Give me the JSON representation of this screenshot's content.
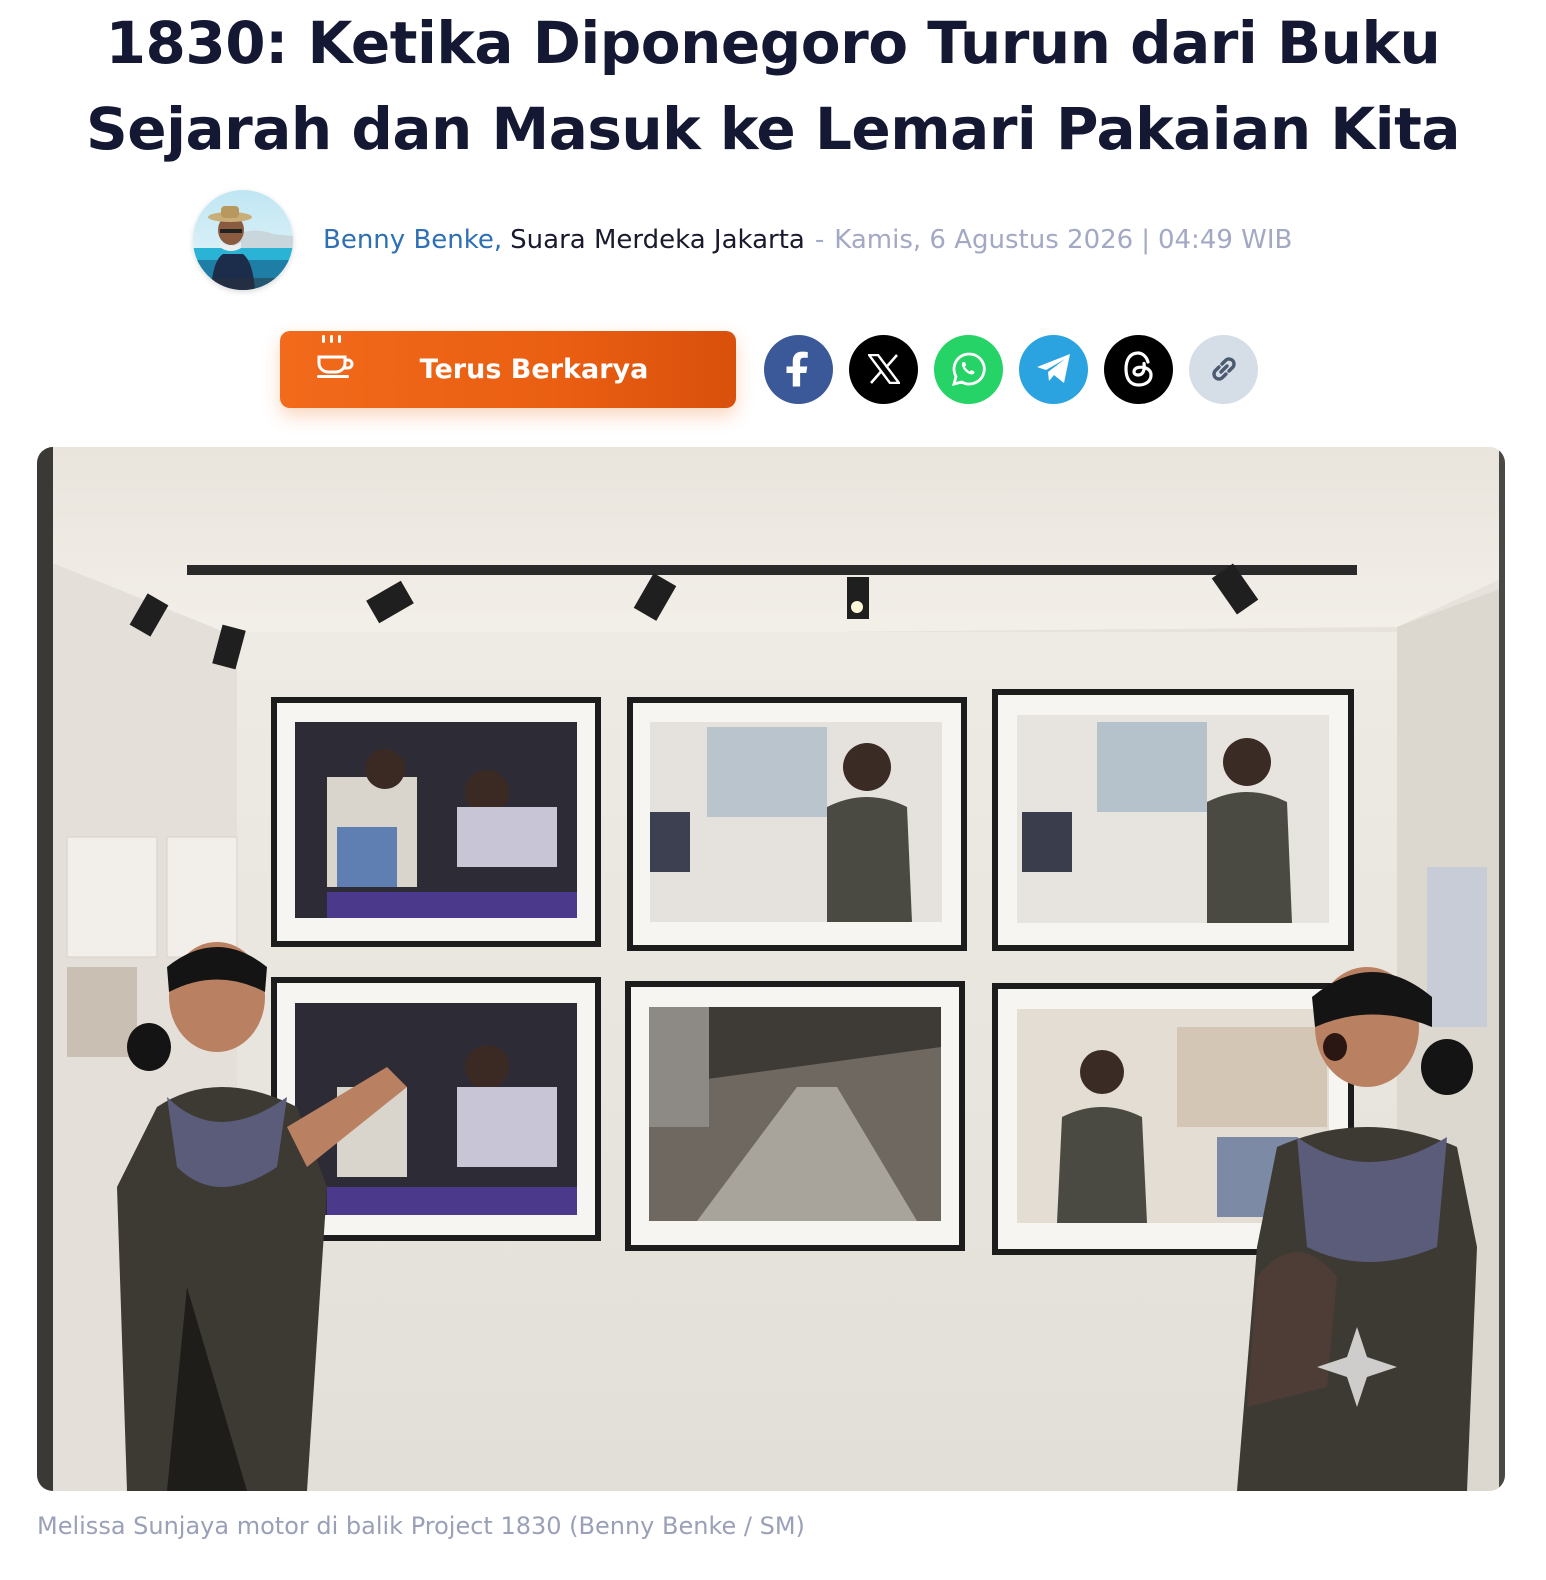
{
  "article": {
    "headline": "1830: Ketika Diponegoro Turun dari Buku Sejarah dan Masuk ke Lemari Pakaian Kita",
    "author": {
      "name": "Benny Benke",
      "separator": ",",
      "outlet": "Suara Merdeka Jakarta"
    },
    "date": {
      "dash": "-",
      "day_date": "Kamis, 6 Agustus 2026",
      "pipe": "|",
      "time": "04:49 WIB"
    },
    "caption": "Melissa Sunjaya motor di balik Project 1830 (Benny Benke / SM)"
  },
  "actions": {
    "support_label": "Terus Berkarya",
    "support_icon": "coffee-cup-icon",
    "share": [
      {
        "name": "facebook-icon",
        "bg": "#3b5998",
        "fg": "#ffffff"
      },
      {
        "name": "x-icon",
        "bg": "#000000",
        "fg": "#ffffff"
      },
      {
        "name": "whatsapp-icon",
        "bg": "#25d366",
        "fg": "#ffffff"
      },
      {
        "name": "telegram-icon",
        "bg": "#2aa3e0",
        "fg": "#ffffff"
      },
      {
        "name": "threads-icon",
        "bg": "#000000",
        "fg": "#ffffff"
      },
      {
        "name": "link-icon",
        "bg": "#d5dde6",
        "fg": "#4b5a6e"
      }
    ]
  },
  "colors": {
    "headline": "#141833",
    "author_link": "#2f6fb3",
    "muted": "#a3a8c4",
    "support_button": "#f26a1b"
  }
}
